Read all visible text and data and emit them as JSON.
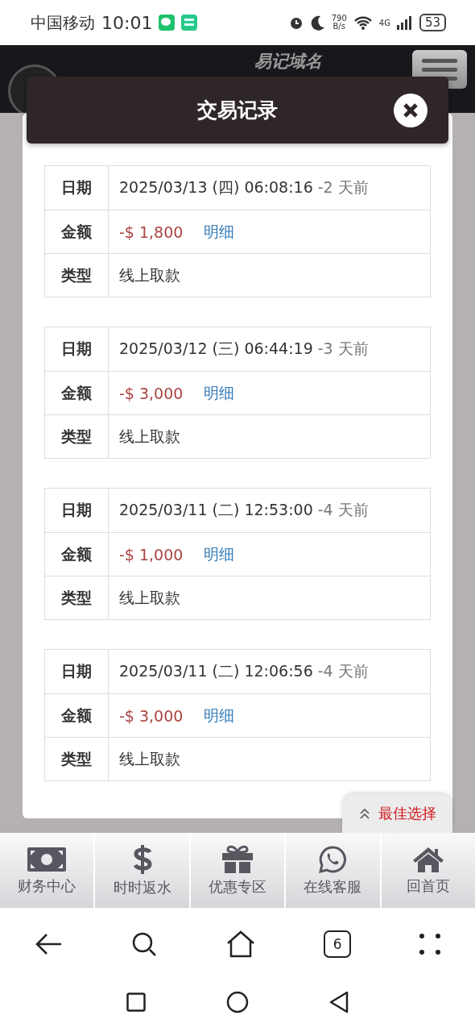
{
  "status_bar": {
    "carrier": "中国移动",
    "time": "10:01",
    "speed_value": "790",
    "speed_unit": "B/s",
    "network": "4G",
    "battery": "53"
  },
  "header": {
    "site_title": "易记域名"
  },
  "modal": {
    "title": "交易记录",
    "records": [
      {
        "rows": [
          {
            "kind": "date",
            "label": "日期",
            "value": "2025/03/13 (四) 06:08:16",
            "note": "-2 天前"
          },
          {
            "kind": "amount",
            "label": "金额",
            "value": "-$ 1,800",
            "link": "明细"
          },
          {
            "kind": "text",
            "label": "类型",
            "value": "线上取款"
          }
        ]
      },
      {
        "rows": [
          {
            "kind": "date",
            "label": "日期",
            "value": "2025/03/12 (三) 06:44:19",
            "note": "-3 天前"
          },
          {
            "kind": "amount",
            "label": "金额",
            "value": "-$ 3,000",
            "link": "明细"
          },
          {
            "kind": "text",
            "label": "类型",
            "value": "线上取款"
          }
        ]
      },
      {
        "rows": [
          {
            "kind": "date",
            "label": "日期",
            "value": "2025/03/11 (二) 12:53:00",
            "note": "-4 天前"
          },
          {
            "kind": "amount",
            "label": "金额",
            "value": "-$ 1,000",
            "link": "明细"
          },
          {
            "kind": "text",
            "label": "类型",
            "value": "线上取款"
          }
        ]
      },
      {
        "rows": [
          {
            "kind": "date",
            "label": "日期",
            "value": "2025/03/11 (二) 12:06:56",
            "note": "-4 天前"
          },
          {
            "kind": "amount",
            "label": "金额",
            "value": "-$ 3,000",
            "link": "明细"
          },
          {
            "kind": "text",
            "label": "类型",
            "value": "线上取款"
          }
        ]
      }
    ]
  },
  "floating_button": {
    "label": "最佳选择"
  },
  "bottom_nav": [
    {
      "kind": "money",
      "label": "财务中心"
    },
    {
      "kind": "dollar",
      "label": "时时返水"
    },
    {
      "kind": "gift",
      "label": "优惠专区"
    },
    {
      "kind": "chat",
      "label": "在线客服"
    },
    {
      "kind": "home",
      "label": "回首页"
    }
  ],
  "browser_bar": {
    "tab_count": "6"
  }
}
